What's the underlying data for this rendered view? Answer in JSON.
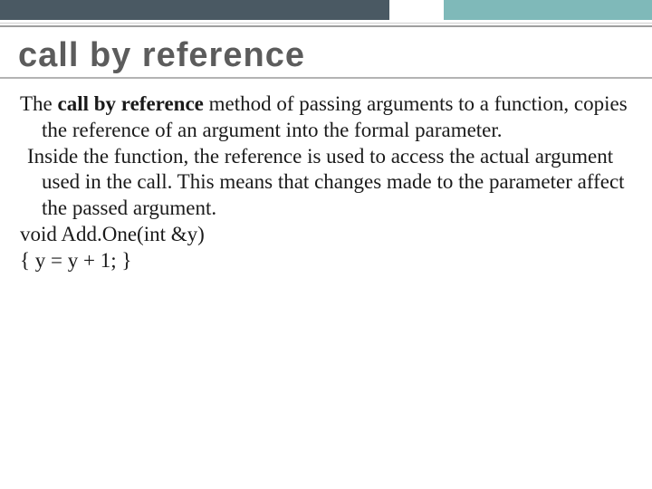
{
  "slide": {
    "title": "call by reference",
    "p1_lead": "The ",
    "p1_bold": "call by reference",
    "p1_rest": " method of passing arguments to a function, copies the reference of an argument into the formal parameter.",
    "p2": " Inside the function, the reference is used to access the actual argument used in the call. This means that changes made to the parameter affect the passed argument.",
    "code1": "void Add.One(int &y)",
    "code2": "{    y = y + 1;  }"
  }
}
